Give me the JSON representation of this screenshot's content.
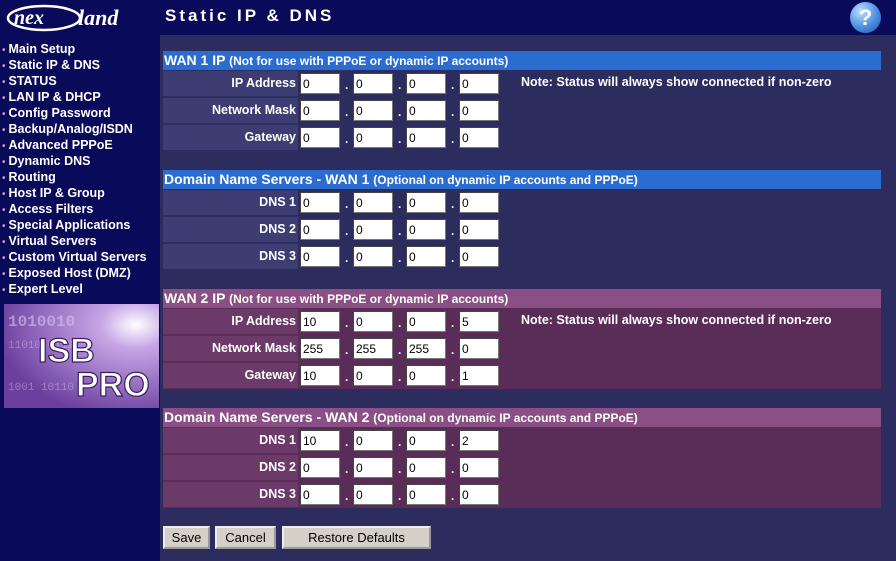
{
  "brand": {
    "logo_text_1": "nex",
    "logo_text_2": "land",
    "badge_line1": "ISB",
    "badge_line2": "PRO"
  },
  "header": {
    "title": "Static IP & DNS",
    "help_label": "?"
  },
  "nav": {
    "items": [
      {
        "label": "Main Setup"
      },
      {
        "label": "Static IP & DNS"
      },
      {
        "label": "STATUS"
      },
      {
        "label": "LAN IP & DHCP"
      },
      {
        "label": "Config Password"
      },
      {
        "label": "Backup/Analog/ISDN"
      },
      {
        "label": "Advanced PPPoE"
      },
      {
        "label": "Dynamic DNS"
      },
      {
        "label": "Routing"
      },
      {
        "label": "Host IP & Group"
      },
      {
        "label": "Access Filters"
      },
      {
        "label": "Special Applications"
      },
      {
        "label": "Virtual Servers"
      },
      {
        "label": "Custom Virtual Servers"
      },
      {
        "label": "Exposed Host (DMZ)"
      },
      {
        "label": "Expert Level"
      }
    ]
  },
  "wan1_ip": {
    "title": "WAN 1 IP",
    "subtitle": "(Not for use with PPPoE or dynamic IP accounts)",
    "note": "Note: Status will always show connected if non-zero",
    "rows": [
      {
        "label": "IP Address",
        "octets": [
          "0",
          "0",
          "0",
          "0"
        ]
      },
      {
        "label": "Network Mask",
        "octets": [
          "0",
          "0",
          "0",
          "0"
        ]
      },
      {
        "label": "Gateway",
        "octets": [
          "0",
          "0",
          "0",
          "0"
        ]
      }
    ]
  },
  "wan1_dns": {
    "title": "Domain Name Servers - WAN 1",
    "subtitle": "(Optional on dynamic IP accounts and PPPoE)",
    "rows": [
      {
        "label": "DNS 1",
        "octets": [
          "0",
          "0",
          "0",
          "0"
        ]
      },
      {
        "label": "DNS 2",
        "octets": [
          "0",
          "0",
          "0",
          "0"
        ]
      },
      {
        "label": "DNS 3",
        "octets": [
          "0",
          "0",
          "0",
          "0"
        ]
      }
    ]
  },
  "wan2_ip": {
    "title": "WAN 2 IP",
    "subtitle": "(Not for use with PPPoE or dynamic IP accounts)",
    "note": "Note: Status will always show connected if non-zero",
    "rows": [
      {
        "label": "IP Address",
        "octets": [
          "10",
          "0",
          "0",
          "5"
        ]
      },
      {
        "label": "Network Mask",
        "octets": [
          "255",
          "255",
          "255",
          "0"
        ]
      },
      {
        "label": "Gateway",
        "octets": [
          "10",
          "0",
          "0",
          "1"
        ]
      }
    ]
  },
  "wan2_dns": {
    "title": "Domain Name Servers - WAN 2",
    "subtitle": "(Optional on dynamic IP accounts and PPPoE)",
    "rows": [
      {
        "label": "DNS 1",
        "octets": [
          "10",
          "0",
          "0",
          "2"
        ]
      },
      {
        "label": "DNS 2",
        "octets": [
          "0",
          "0",
          "0",
          "0"
        ]
      },
      {
        "label": "DNS 3",
        "octets": [
          "0",
          "0",
          "0",
          "0"
        ]
      }
    ]
  },
  "buttons": {
    "save": "Save",
    "cancel": "Cancel",
    "restore": "Restore Defaults"
  },
  "colors": {
    "bg": "#2c2c5e",
    "sidebar": "#0a0a5a",
    "header_blue": "#2b6cd1",
    "header_purple": "#8a4f84",
    "body_purple": "#5a2c58"
  }
}
